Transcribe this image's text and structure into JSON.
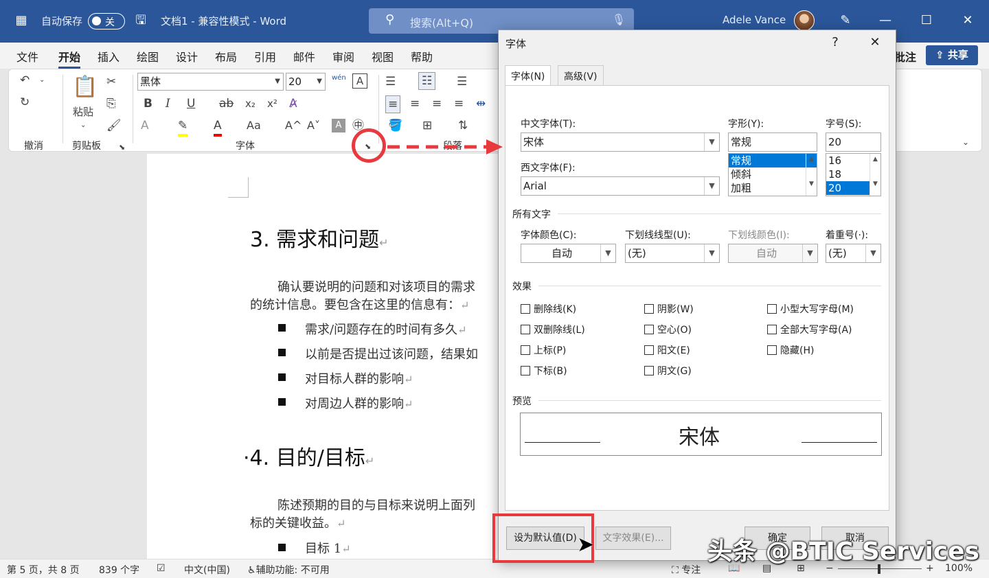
{
  "titlebar": {
    "autosave": "自动保存",
    "toggle": "关",
    "doc_title": "文档1  -  兼容性模式  -  Word",
    "search_placeholder": "搜索(Alt+Q)",
    "user": "Adele Vance"
  },
  "menu": {
    "tabs": [
      "文件",
      "开始",
      "插入",
      "绘图",
      "设计",
      "布局",
      "引用",
      "邮件",
      "审阅",
      "视图",
      "帮助"
    ],
    "comment": "批注",
    "share": "共享"
  },
  "ribbon": {
    "undo_group": "撤消",
    "clipboard_group": "剪贴板",
    "paste": "粘贴",
    "font_group": "字体",
    "paragraph_group": "段落",
    "font_name": "黑体",
    "font_size": "20",
    "bold": "B",
    "italic": "I",
    "underline": "U",
    "strike": "ab",
    "subscript": "x₂",
    "superscript": "x²",
    "change_case": "Aa",
    "grow": "A^",
    "shrink": "A˅",
    "phonetic": "wén"
  },
  "document": {
    "heading3": "3. 需求和问题",
    "para1_line1": "确认要说明的问题和对该项目的需求",
    "para1_line2": "的统计信息。要包含在这里的信息有：",
    "bullets1": [
      "需求/问题存在的时间有多久",
      "以前是否提出过该问题，结果如",
      "对目标人群的影响",
      "对周边人群的影响"
    ],
    "heading4": "4. 目的/目标",
    "para2_line1": "陈述预期的目的与目标来说明上面列",
    "para2_line2": "标的关键收益。",
    "bullet2": "目标 1"
  },
  "statusbar": {
    "page": "第 5 页，共 8 页",
    "words": "839 个字",
    "lang": "中文(中国)",
    "accessibility": "辅助功能: 不可用",
    "focus": "专注",
    "zoom": "100%"
  },
  "dialog": {
    "title": "字体",
    "help": "?",
    "close": "✕",
    "tab_font": "字体(N)",
    "tab_advanced": "高级(V)",
    "cn_font_label": "中文字体(T):",
    "cn_font_value": "宋体",
    "west_font_label": "西文字体(F):",
    "west_font_value": "Arial",
    "style_label": "字形(Y):",
    "style_value": "常规",
    "style_options": [
      "常规",
      "倾斜",
      "加粗"
    ],
    "size_label": "字号(S):",
    "size_value": "20",
    "size_options": [
      "16",
      "18",
      "20"
    ],
    "all_text": "所有文字",
    "color_label": "字体颜色(C):",
    "color_value": "自动",
    "underline_label": "下划线线型(U):",
    "underline_value": "(无)",
    "underline_color_label": "下划线颜色(I):",
    "underline_color_value": "自动",
    "emphasis_label": "着重号(·):",
    "emphasis_value": "(无)",
    "effects": "效果",
    "effect_items": [
      [
        "删除线(K)",
        "阴影(W)",
        "小型大写字母(M)"
      ],
      [
        "双删除线(L)",
        "空心(O)",
        "全部大写字母(A)"
      ],
      [
        "上标(P)",
        "阳文(E)",
        "隐藏(H)"
      ],
      [
        "下标(B)",
        "阴文(G)",
        ""
      ]
    ],
    "preview_label": "预览",
    "preview_text": "宋体",
    "set_default": "设为默认值(D)",
    "text_effects": "文字效果(E)...",
    "ok": "确定",
    "cancel": "取消"
  },
  "watermark": "头条 @BTIC Services",
  "colors": {
    "titlebar": "#2b579a",
    "accent_red": "#e8393f",
    "selection": "#0078d7"
  }
}
